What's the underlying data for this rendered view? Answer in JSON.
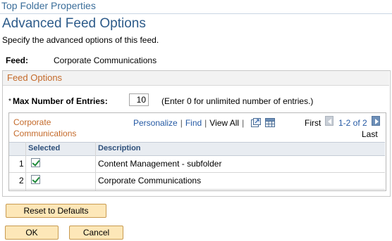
{
  "window_title": "Top Folder Properties",
  "page": {
    "title": "Advanced Feed Options",
    "description": "Specify the advanced options of this feed."
  },
  "feed": {
    "label": "Feed:",
    "value": "Corporate Communications"
  },
  "feed_options": {
    "title": "Feed Options",
    "required_marker": "*",
    "max_entries_label": "Max Number of Entries:",
    "max_entries_value": "10",
    "max_entries_hint": "(Enter 0 for unlimited number of entries.)"
  },
  "grid": {
    "title": "Corporate Communications",
    "personalize": "Personalize",
    "find": "Find",
    "view_all": "View All",
    "first": "First",
    "range": "1-2 of 2",
    "last": "Last",
    "columns": [
      "Selected",
      "Description"
    ],
    "rows": [
      {
        "num": "1",
        "selected": true,
        "description": "Content Management - subfolder"
      },
      {
        "num": "2",
        "selected": true,
        "description": "Corporate Communications"
      }
    ]
  },
  "buttons": {
    "reset": "Reset to Defaults",
    "ok": "OK",
    "cancel": "Cancel"
  },
  "icons": {
    "zoom": "zoom-icon",
    "download": "download-grid-icon",
    "prev": "previous-arrow-icon",
    "next": "next-arrow-icon"
  }
}
